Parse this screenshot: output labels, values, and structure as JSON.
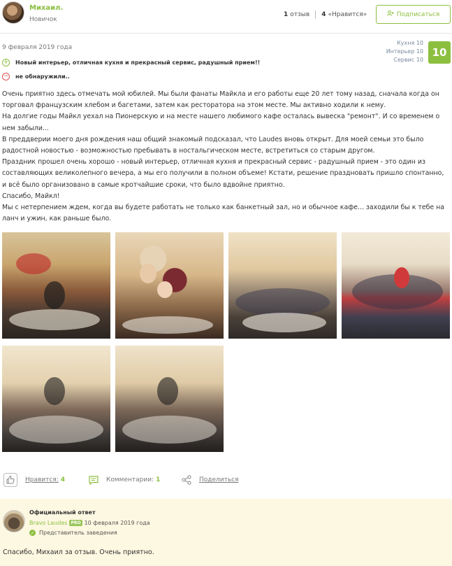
{
  "user": {
    "name": "Михаил.",
    "rank": "Новичок",
    "reviews_count": "1",
    "reviews_label": "отзыв",
    "likes_count": "4",
    "likes_label": "«Нравится»"
  },
  "subscribe_label": "Подписаться",
  "review": {
    "date": "9 февраля 2019 года",
    "scores": [
      "Кухня 10",
      "Интерьер 10",
      "Сервис 10"
    ],
    "total_score": "10",
    "pros": "Новый интерьер, отличная кухня и прекрасный сервис, радушный прием!!",
    "cons": "не обнаружили..",
    "text": [
      "Очень приятно здесь отмечать мой юбилей. Мы были фанаты Майкла и его работы еще 20 лет тому назад, сначала когда он торговал французским хлебом и багетами, затем как ресторатора на этом месте. Мы активно ходили к нему.",
      "На долгие годы Майкл уехал на Пионерскую и на месте нашего любимого кафе осталась вывеска \"ремонт\". И со временем о нем забыли...",
      "В преддверии моего дня рождения наш общий знакомый подсказал, что Laudes вновь открыт. Для моей семьи это было радостной новостью - возможностью пребывать в ностальгическом месте, встретиться со старым другом.",
      "Праздник прошел очень хорошо - новый интерьер, отличная кухня и прекрасный сервис - радушный прием - это один из составляющих великолепного вечера, а мы его получили в полном объеме! Кстати, решение праздновать пришло спонтанно, и всё было организовано в самые кротчайшие сроки, что было вдвойне приятно.",
      "Спасибо, Майкл!",
      "Мы с нетерпением ждем, когда вы будете работать не только как банкетный зал, но и обычное кафе... заходили бы к тебе на ланч и ужин, как раньше было."
    ]
  },
  "actions": {
    "like_label": "Нравится:",
    "like_count": "4",
    "comments_label": "Комментарии:",
    "comments_count": "1",
    "share_label": "Поделиться"
  },
  "official_answer": {
    "title": "Официальный ответ",
    "name": "Bravo Laudes",
    "badge": "PRO",
    "date": "10 февраля 2019 года",
    "role": "Представитель заведения",
    "text": "Спасибо, Михаил за отзыв. Очень приятно."
  },
  "colors": {
    "accent": "#8cbf3f",
    "answer_bg": "#fdf8e1",
    "cons": "#e05050"
  }
}
